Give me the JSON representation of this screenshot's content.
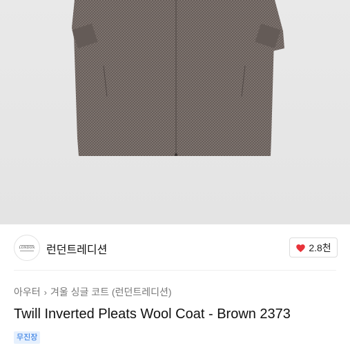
{
  "brand": {
    "name": "런던트레디션",
    "logo_text": "LONDON"
  },
  "like": {
    "count": "2.8천",
    "color": "#e8333a"
  },
  "breadcrumb": {
    "items": [
      "아우터",
      "겨울 싱글 코트 (런던트레디션)"
    ]
  },
  "product": {
    "title": "Twill Inverted Pleats Wool Coat - Brown 2373",
    "badge": "무진장"
  },
  "colors": {
    "accent": "#1f6fe0",
    "badge_bg": "#e6f0fd",
    "hero_bg": "#e7e7e7"
  }
}
